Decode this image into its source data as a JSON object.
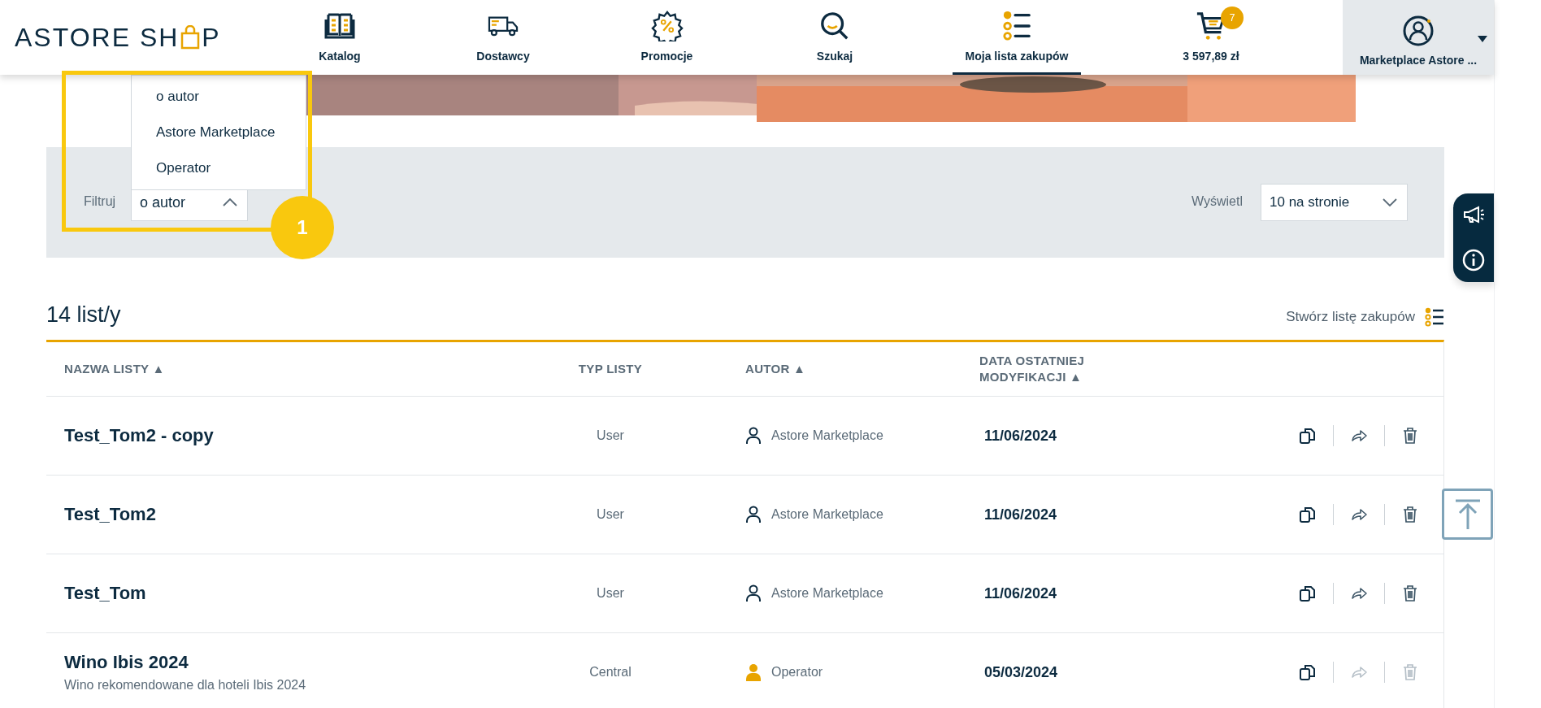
{
  "logo": {
    "text_start": "ASTORE SH",
    "text_end": "P"
  },
  "nav": [
    {
      "kind": "catalog",
      "label": "Katalog",
      "selected": false
    },
    {
      "kind": "truck",
      "label": "Dostawcy",
      "selected": false
    },
    {
      "kind": "promo",
      "label": "Promocje",
      "selected": false
    },
    {
      "kind": "search",
      "label": "Szukaj",
      "selected": false
    },
    {
      "kind": "list",
      "label": "Moja lista zakupów",
      "selected": true
    },
    {
      "kind": "cart",
      "label": "3 597,89 zł",
      "badge": "7",
      "selected": false
    }
  ],
  "account": {
    "label": "Marketplace Astore ..."
  },
  "filter": {
    "label": "Filtruj",
    "value": "o autor",
    "expanded": true,
    "options": [
      "o autor",
      "Astore Marketplace",
      "Operator"
    ]
  },
  "page_size": {
    "label": "Wyświetl",
    "value": "10 na stronie"
  },
  "annotation": {
    "number": "1"
  },
  "count_title": "14 list/y",
  "create_link": "Stwórz listę zakupów",
  "table": {
    "columns": [
      {
        "label": "NAZWA LISTY",
        "sort_mark": "▲"
      },
      {
        "label": "TYP LISTY"
      },
      {
        "label": "AUTOR",
        "sort_mark": "▲"
      },
      {
        "label": "DATA OSTATNIEJ MODYFIKACJI",
        "sort_mark": "▲"
      }
    ],
    "rows": [
      {
        "name": "Test_Tom2 - copy",
        "type": "User",
        "author": {
          "name": "Astore Marketplace",
          "kind": "user"
        },
        "date": "11/06/2024",
        "share_disabled": false,
        "delete_disabled": false
      },
      {
        "name": "Test_Tom2",
        "type": "User",
        "author": {
          "name": "Astore Marketplace",
          "kind": "user"
        },
        "date": "11/06/2024",
        "share_disabled": false,
        "delete_disabled": false
      },
      {
        "name": "Test_Tom",
        "type": "User",
        "author": {
          "name": "Astore Marketplace",
          "kind": "user"
        },
        "date": "11/06/2024",
        "share_disabled": false,
        "delete_disabled": false
      },
      {
        "name": "Wino Ibis 2024",
        "description": "Wino rekomendowane dla hoteli Ibis 2024",
        "type": "Central",
        "author": {
          "name": "Operator",
          "kind": "operator"
        },
        "date": "05/03/2024",
        "share_disabled": true,
        "delete_disabled": true
      }
    ]
  }
}
